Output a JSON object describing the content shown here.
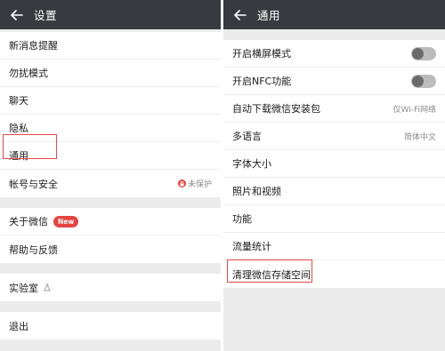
{
  "left": {
    "title": "设置",
    "groups": [
      [
        {
          "label": "新消息提醒"
        },
        {
          "label": "勿扰模式"
        },
        {
          "label": "聊天"
        },
        {
          "label": "隐私"
        },
        {
          "label": "通用"
        },
        {
          "label": "帐号与安全",
          "status": "未保护",
          "status_icon": "lock-icon"
        }
      ],
      [
        {
          "label": "关于微信",
          "badge": "New"
        },
        {
          "label": "帮助与反馈"
        }
      ],
      [
        {
          "label": "实验室",
          "icon": "lab-icon"
        }
      ],
      [
        {
          "label": "退出"
        }
      ]
    ]
  },
  "right": {
    "title": "通用",
    "items": [
      {
        "label": "开启横屏模式",
        "toggle": false
      },
      {
        "label": "开启NFC功能",
        "toggle": false
      },
      {
        "label": "自动下载微信安装包",
        "value": "仅Wi-Fi网络"
      },
      {
        "label": "多语言",
        "value": "简体中文"
      },
      {
        "label": "字体大小"
      },
      {
        "label": "照片和视频"
      },
      {
        "label": "功能"
      },
      {
        "label": "流量统计"
      },
      {
        "label": "清理微信存储空间"
      }
    ]
  },
  "colors": {
    "header_bg": "#393a3f",
    "highlight": "#e84848",
    "badge": "#e64340",
    "page_bg": "#ececec"
  },
  "icons": {
    "back": "arrow-left-icon"
  }
}
